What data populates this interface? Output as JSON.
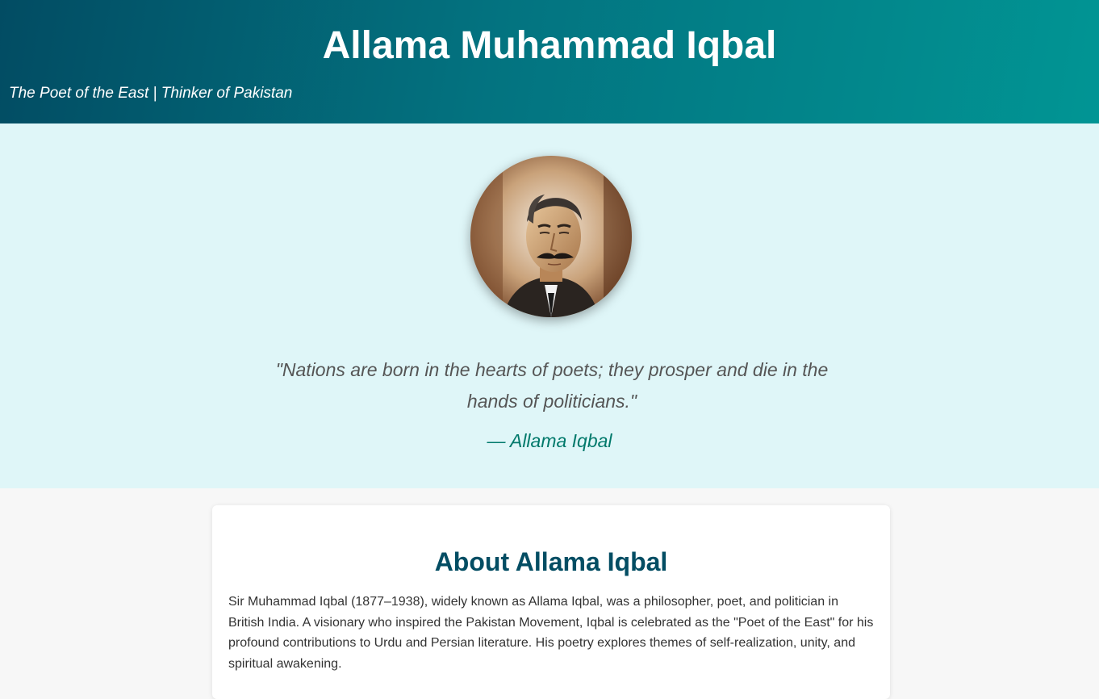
{
  "header": {
    "title": "Allama Muhammad Iqbal",
    "tagline": "The Poet of the East | Thinker of Pakistan",
    "gradient_start": "#024c63",
    "gradient_end": "#019594"
  },
  "hero": {
    "background": "#dff6f8",
    "portrait_icon": "portrait-photo",
    "quote": "\"Nations are born in the hearts of poets; they prosper and die in the hands of politicians.\"",
    "quote_author": "— Allama Iqbal"
  },
  "about": {
    "heading": "About Allama Iqbal",
    "paragraph": "Sir Muhammad Iqbal (1877–1938), widely known as Allama Iqbal, was a philosopher, poet, and politician in British India. A visionary who inspired the Pakistan Movement, Iqbal is celebrated as the \"Poet of the East\" for his profound contributions to Urdu and Persian literature. His poetry explores themes of self-realization, unity, and spiritual awakening."
  },
  "colors": {
    "heading": "#034d63",
    "accent": "#00796b",
    "page_background": "#f7f7f7"
  }
}
